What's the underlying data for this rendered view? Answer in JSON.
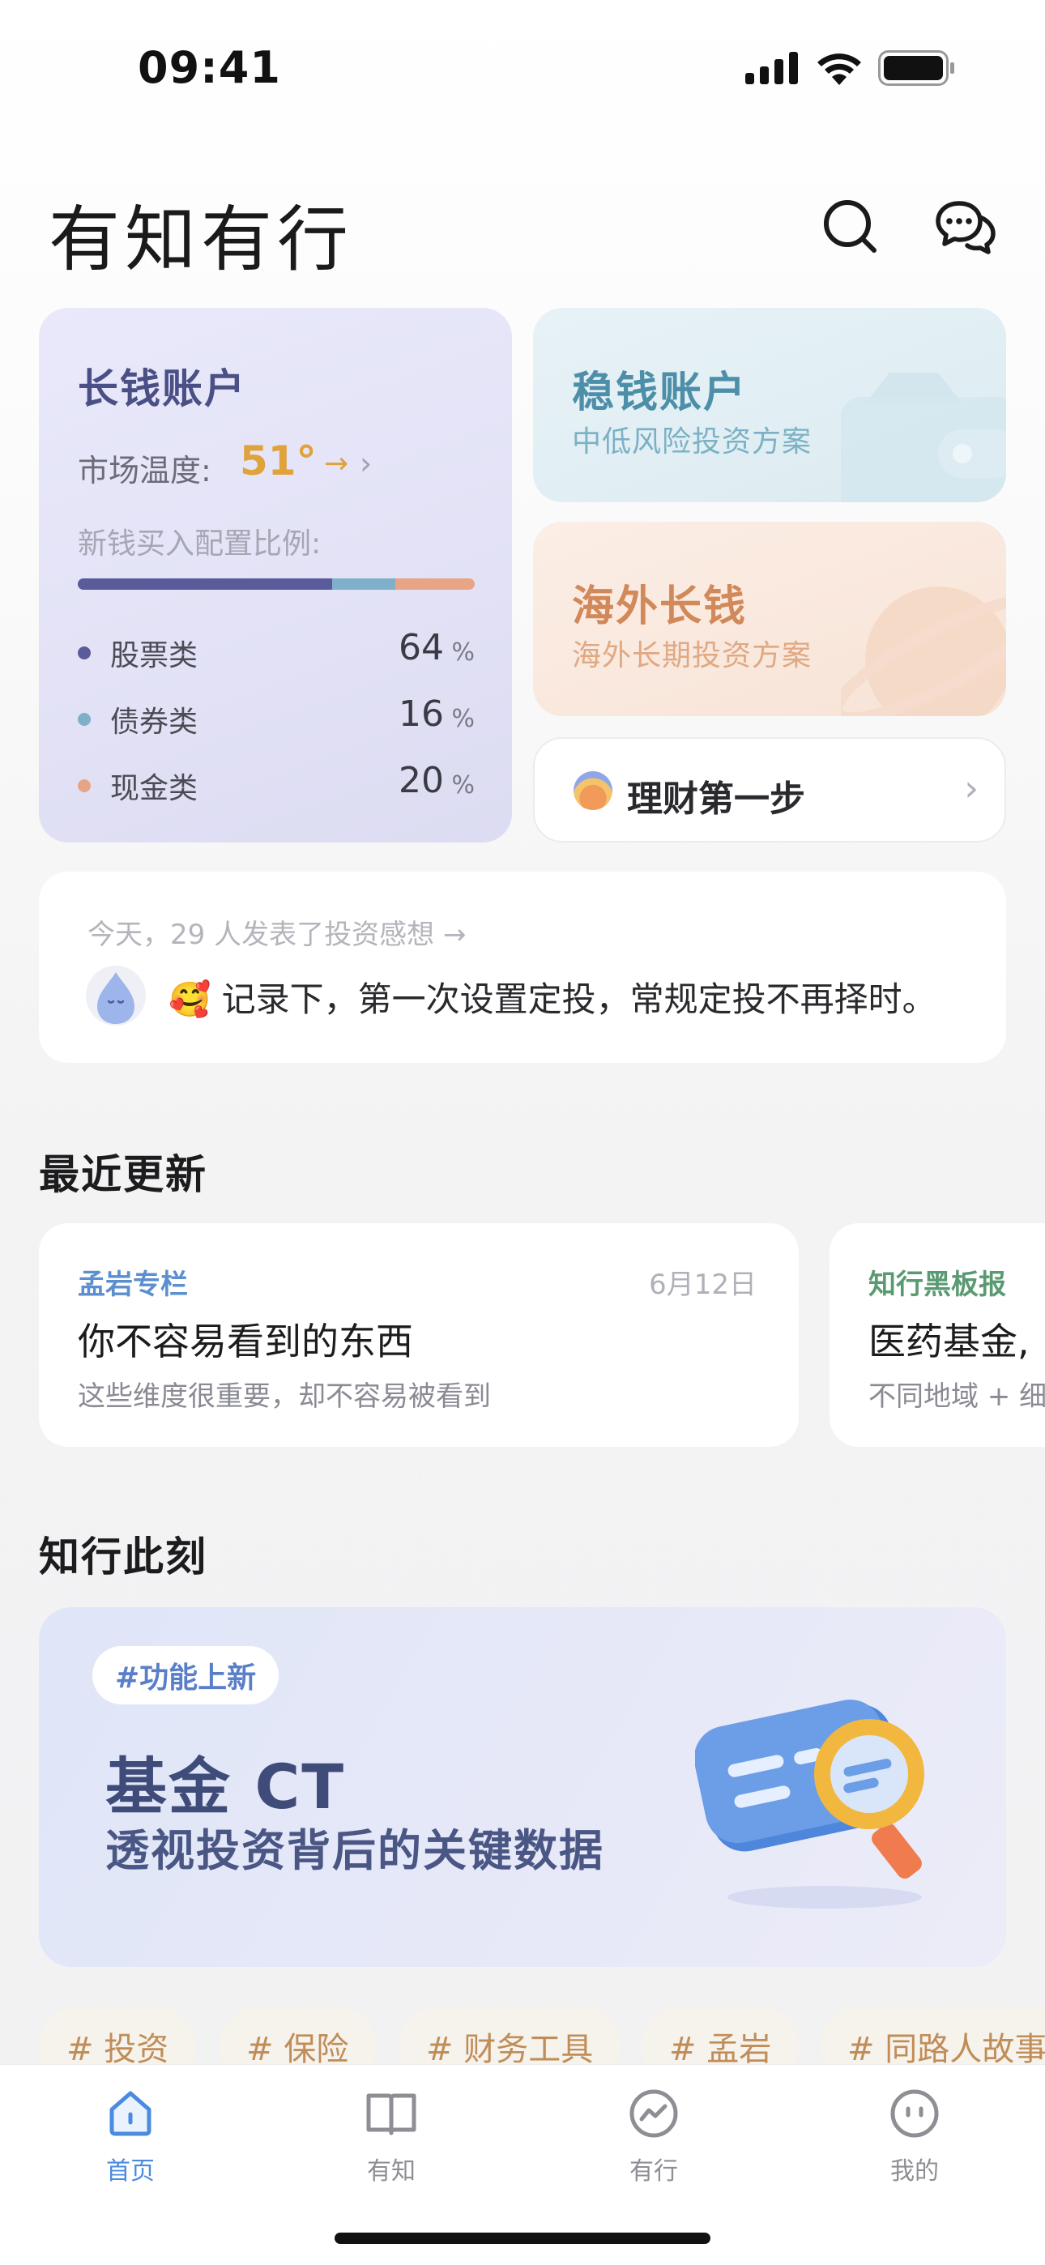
{
  "status_bar": {
    "time": "09:41"
  },
  "header": {
    "title": "有知有行",
    "search_icon": "search-icon",
    "chat_icon": "chat-icon"
  },
  "long_account": {
    "title": "长钱账户",
    "temperature_label": "市场温度:",
    "temperature_value": "51°",
    "temperature_trend": "→",
    "chevron": "›",
    "ratio_label": "新钱买入配置比例:",
    "allocations": [
      {
        "name": "股票类",
        "value": "64",
        "unit": "%",
        "color": "#5a5b9a",
        "fraction": 0.64
      },
      {
        "name": "债券类",
        "value": "16",
        "unit": "%",
        "color": "#7fb0c9",
        "fraction": 0.16
      },
      {
        "name": "现金类",
        "value": "20",
        "unit": "%",
        "color": "#e8a586",
        "fraction": 0.2
      }
    ]
  },
  "stable_account": {
    "title": "稳钱账户",
    "subtitle": "中低风险投资方案",
    "title_color": "#4d8fa8",
    "subtitle_color": "#7bb1c4"
  },
  "overseas_account": {
    "title": "海外长钱",
    "subtitle": "海外长期投资方案",
    "title_color": "#d2895a",
    "subtitle_color": "#e0a883"
  },
  "first_step": {
    "label": "理财第一步",
    "chevron": "›"
  },
  "feed": {
    "meta": "今天，29 人发表了投资感想 →",
    "emoji": "🥰",
    "message": "记录下，第一次设置定投，常规定投不再择时。"
  },
  "recent_updates": {
    "title": "最近更新",
    "items": [
      {
        "column": "孟岩专栏",
        "date": "6月12日",
        "title": "你不容易看到的东西",
        "subtitle": "这些维度很重要，却不容易被看到",
        "column_color": "#5b8fcf"
      },
      {
        "column": "知行黑板报",
        "date": "",
        "title": "医药基金,",
        "subtitle": "不同地域 + 细",
        "column_color": "#5a9a72"
      }
    ]
  },
  "moment": {
    "title": "知行此刻",
    "tag": "#功能上新",
    "headline": "基金 CT",
    "subheadline": "透视投资背后的关键数据"
  },
  "chips": [
    "# 投资",
    "# 保险",
    "# 财务工具",
    "# 孟岩",
    "# 同路人故事"
  ],
  "tabbar": {
    "tabs": [
      {
        "label": "首页",
        "icon": "home-icon",
        "active": true
      },
      {
        "label": "有知",
        "icon": "book-icon",
        "active": false
      },
      {
        "label": "有行",
        "icon": "trend-icon",
        "active": false
      },
      {
        "label": "我的",
        "icon": "profile-icon",
        "active": false
      }
    ],
    "accent": "#4a8be0"
  }
}
